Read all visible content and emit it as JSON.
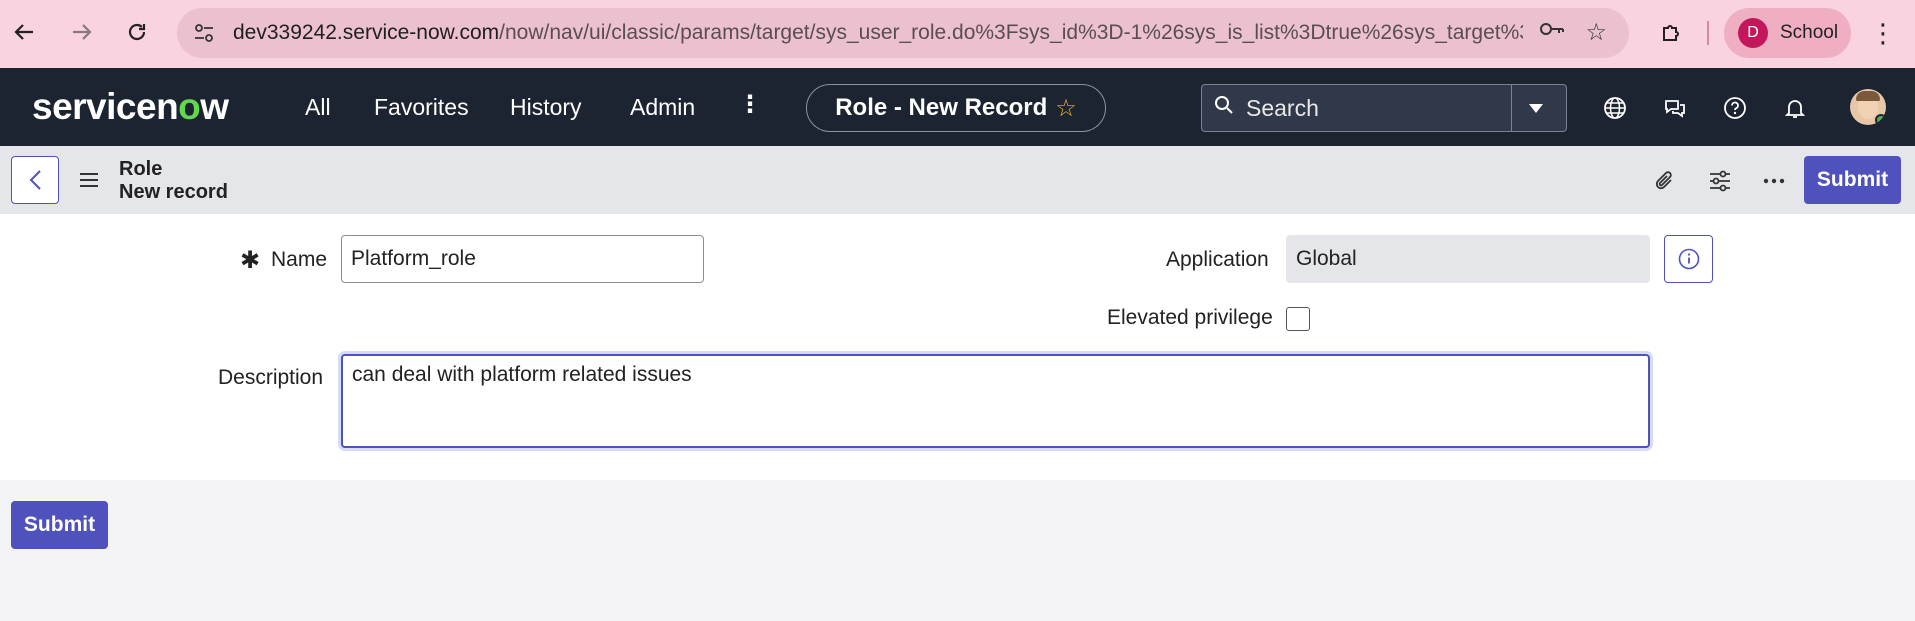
{
  "browser": {
    "url_host": "dev339242.service-now.com",
    "url_path": "/now/nav/ui/classic/params/target/sys_user_role.do%3Fsys_id%3D-1%26sys_is_list%3Dtrue%26sys_target%3...",
    "profile_initial": "D",
    "profile_name": "School"
  },
  "header": {
    "logo_pre": "servicen",
    "logo_o": "o",
    "logo_post": "w",
    "menu": [
      "All",
      "Favorites",
      "History",
      "Admin"
    ],
    "record_title": "Role - New Record",
    "search_placeholder": "Search"
  },
  "form_bar": {
    "title": "Role",
    "subtitle": "New record",
    "submit_label": "Submit"
  },
  "form": {
    "name_label": "Name",
    "name_value": "Platform_role",
    "application_label": "Application",
    "application_value": "Global",
    "elevated_label": "Elevated privilege",
    "elevated_checked": false,
    "description_label": "Description",
    "description_value": "can deal with platform related issues"
  },
  "footer": {
    "submit_label": "Submit"
  },
  "colors": {
    "accent": "#4f52bd",
    "header_bg": "#1c2331",
    "chrome_bg": "#f9d3df"
  }
}
